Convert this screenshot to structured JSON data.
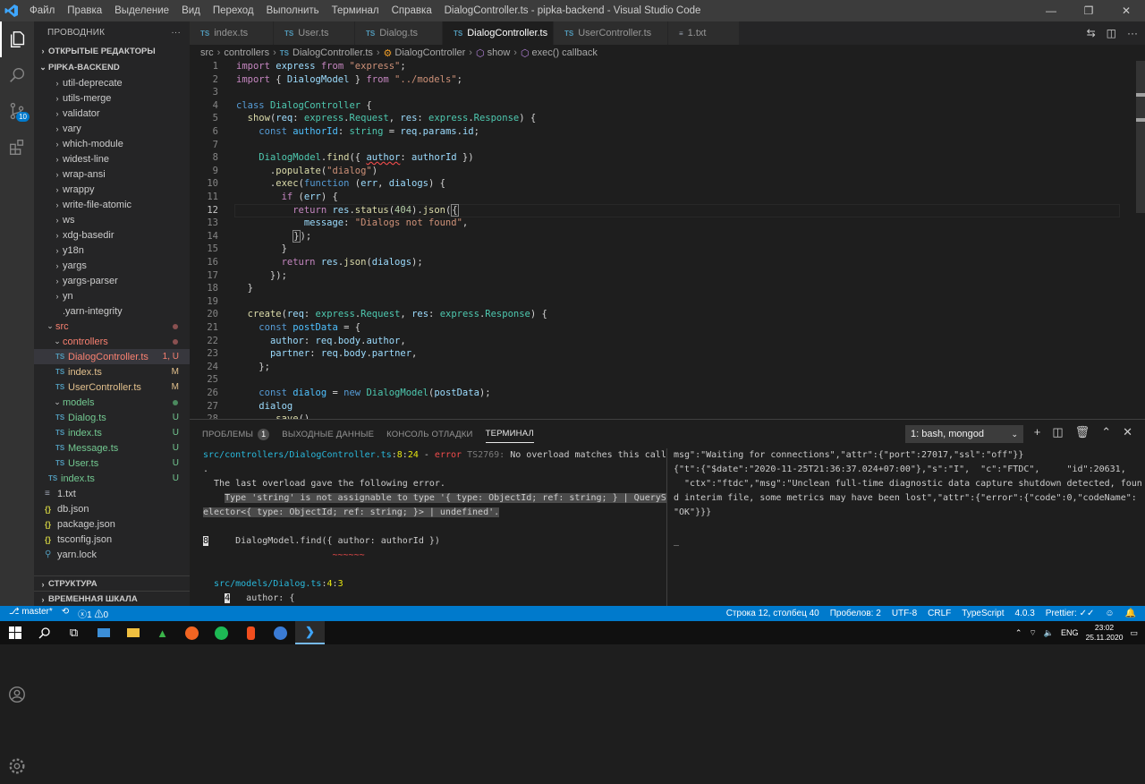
{
  "titlebar": {
    "menu": [
      "Файл",
      "Правка",
      "Выделение",
      "Вид",
      "Переход",
      "Выполнить",
      "Терминал",
      "Справка"
    ],
    "title": "DialogController.ts - pipka-backend - Visual Studio Code"
  },
  "sidebar": {
    "title": "ПРОВОДНИК",
    "open_editors": "ОТКРЫТЫЕ РЕДАКТОРЫ",
    "project": "PIPKA-BACKEND",
    "items": [
      {
        "label": "util-deprecate"
      },
      {
        "label": "utils-merge"
      },
      {
        "label": "validator"
      },
      {
        "label": "vary"
      },
      {
        "label": "which-module"
      },
      {
        "label": "widest-line"
      },
      {
        "label": "wrap-ansi"
      },
      {
        "label": "wrappy"
      },
      {
        "label": "write-file-atomic"
      },
      {
        "label": "ws"
      },
      {
        "label": "xdg-basedir"
      },
      {
        "label": "y18n"
      },
      {
        "label": "yargs"
      },
      {
        "label": "yargs-parser"
      },
      {
        "label": "yn"
      },
      {
        "label": ".yarn-integrity"
      },
      {
        "label": "src"
      },
      {
        "label": "controllers"
      },
      {
        "label": "DialogController.ts",
        "status": "1, U"
      },
      {
        "label": "index.ts",
        "status": "M"
      },
      {
        "label": "UserController.ts",
        "status": "M"
      },
      {
        "label": "models"
      },
      {
        "label": "Dialog.ts",
        "status": "U"
      },
      {
        "label": "index.ts",
        "status": "U"
      },
      {
        "label": "Message.ts",
        "status": "U"
      },
      {
        "label": "User.ts",
        "status": "U"
      },
      {
        "label": "index.ts",
        "status": "U"
      },
      {
        "label": "1.txt"
      },
      {
        "label": "db.json"
      },
      {
        "label": "package.json"
      },
      {
        "label": "tsconfig.json"
      },
      {
        "label": "yarn.lock"
      }
    ],
    "structure": "СТРУКТУРА",
    "timeline": "ВРЕМЕННАЯ ШКАЛА"
  },
  "tabs": [
    {
      "label": "index.ts",
      "icon": "TS"
    },
    {
      "label": "User.ts",
      "icon": "TS"
    },
    {
      "label": "Dialog.ts",
      "icon": "TS"
    },
    {
      "label": "DialogController.ts",
      "icon": "TS"
    },
    {
      "label": "UserController.ts",
      "icon": "TS"
    },
    {
      "label": "1.txt",
      "icon": "≡"
    }
  ],
  "breadcrumb": [
    "src",
    "controllers",
    "DialogController.ts",
    "DialogController",
    "show",
    "exec() callback"
  ],
  "editor": {
    "line_numbers": [
      "1",
      "2",
      "3",
      "4",
      "5",
      "6",
      "7",
      "8",
      "9",
      "10",
      "11",
      "12",
      "13",
      "14",
      "15",
      "16",
      "17",
      "18",
      "19",
      "20",
      "21",
      "22",
      "23",
      "24",
      "25",
      "26",
      "27",
      "28"
    ]
  },
  "panel": {
    "tabs": [
      "ПРОБЛЕМЫ",
      "ВЫХОДНЫЕ ДАННЫЕ",
      "КОНСОЛЬ ОТЛАДКИ",
      "ТЕРМИНАЛ"
    ],
    "problems_count": "1",
    "terminal_select": "1: bash, mongod"
  },
  "statusbar": {
    "branch": "master*",
    "errors": "1",
    "warnings": "0",
    "position": "Строка 12, столбец 40",
    "spaces": "Пробелов: 2",
    "encoding": "UTF-8",
    "eol": "CRLF",
    "language": "TypeScript",
    "version": "4.0.3",
    "prettier": "Prettier: ✓✓"
  },
  "taskbar": {
    "lang": "ENG",
    "time": "23:02",
    "date": "25.11.2020"
  }
}
